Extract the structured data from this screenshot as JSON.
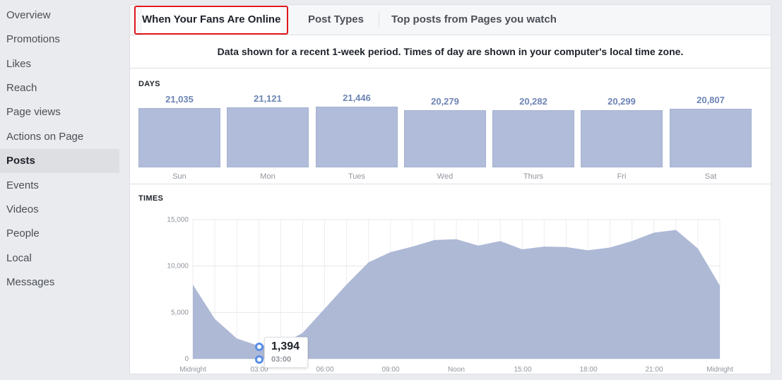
{
  "sidebar": {
    "items": [
      {
        "label": "Overview",
        "active": false
      },
      {
        "label": "Promotions",
        "active": false
      },
      {
        "label": "Likes",
        "active": false
      },
      {
        "label": "Reach",
        "active": false
      },
      {
        "label": "Page views",
        "active": false
      },
      {
        "label": "Actions on Page",
        "active": false
      },
      {
        "label": "Posts",
        "active": true
      },
      {
        "label": "Events",
        "active": false
      },
      {
        "label": "Videos",
        "active": false
      },
      {
        "label": "People",
        "active": false
      },
      {
        "label": "Local",
        "active": false
      },
      {
        "label": "Messages",
        "active": false
      }
    ]
  },
  "tabs": [
    {
      "label": "When Your Fans Are Online",
      "active": true
    },
    {
      "label": "Post Types",
      "active": false
    },
    {
      "label": "Top posts from Pages you watch",
      "active": false
    }
  ],
  "info_text": "Data shown for a recent 1-week period. Times of day are shown in your computer's local time zone.",
  "days_label": "DAYS",
  "times_label": "TIMES",
  "tooltip": {
    "value": "1,394",
    "time": "03:00"
  },
  "colors": {
    "bar": "#b0bcd9",
    "area": "#aeb9d6",
    "marker": "#5b8ee6",
    "highlight": "#e0161c"
  },
  "chart_data": [
    {
      "type": "bar",
      "title": "DAYS",
      "categories": [
        "Sun",
        "Mon",
        "Tues",
        "Wed",
        "Thurs",
        "Fri",
        "Sat"
      ],
      "values": [
        21035,
        21121,
        21446,
        20279,
        20282,
        20299,
        20807
      ],
      "labels": [
        "21,035",
        "21,121",
        "21,446",
        "20,279",
        "20,282",
        "20,299",
        "20,807"
      ]
    },
    {
      "type": "area",
      "title": "TIMES",
      "ylim": [
        0,
        15000
      ],
      "yticks": [
        0,
        5000,
        10000,
        15000
      ],
      "ytick_labels": [
        "0",
        "5,000",
        "10,000",
        "15,000"
      ],
      "xlim": [
        0,
        23
      ],
      "xticks": [
        0,
        3,
        6,
        9,
        12,
        15,
        18,
        21,
        23
      ],
      "xtick_labels": [
        "Midnight",
        "03:00",
        "06:00",
        "09:00",
        "Noon",
        "15:00",
        "18:00",
        "21:00",
        "Midnight"
      ],
      "x": [
        0,
        1,
        2,
        3,
        4,
        5,
        6,
        7,
        8,
        9,
        10,
        11,
        12,
        13,
        14,
        15,
        16,
        17,
        18,
        19,
        20,
        21,
        22,
        23
      ],
      "values": [
        8000,
        4300,
        2200,
        1394,
        1500,
        2800,
        5400,
        8000,
        10400,
        11500,
        12100,
        12800,
        12900,
        12200,
        12700,
        11800,
        12100,
        12050,
        11700,
        12000,
        12700,
        13600,
        13900,
        11900,
        7900
      ],
      "highlight": {
        "x": 3,
        "value": 1394
      }
    }
  ]
}
